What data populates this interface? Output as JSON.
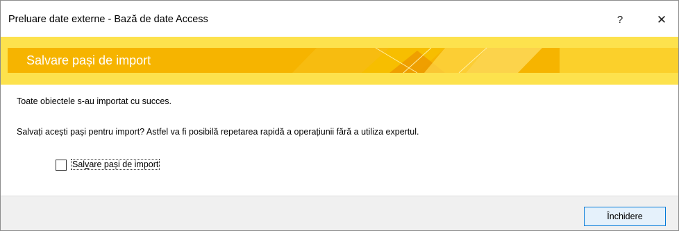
{
  "window": {
    "title": "Preluare date externe - Bază de date Access",
    "help_glyph": "?",
    "close_glyph": "✕"
  },
  "banner": {
    "title": "Salvare pași de import"
  },
  "content": {
    "success_message": "Toate obiectele s-au importat cu succes.",
    "question": "Salvați acești pași pentru import? Astfel va fi posibilă repetarea rapidă a operațiunii fără a utiliza expertul.",
    "checkbox": {
      "label_before": "Sal",
      "label_mnemonic": "v",
      "label_after": "are pași de import",
      "checked": false
    }
  },
  "footer": {
    "close_button_label": "Închidere"
  },
  "colors": {
    "banner_light": "#fde24d",
    "banner_band": "#f6b400",
    "button_accent": "#0078d7"
  }
}
